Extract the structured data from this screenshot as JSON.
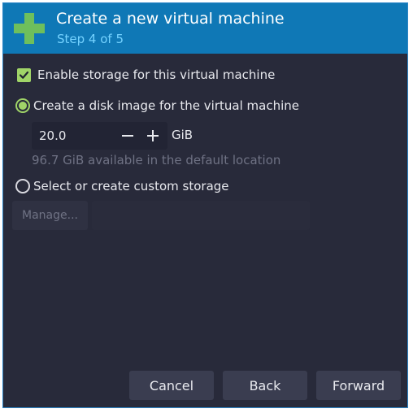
{
  "header": {
    "title": "Create a new virtual machine",
    "subtitle": "Step 4 of 5",
    "logo_icon": "plus-icon",
    "logo_color": "#6ebf5c",
    "background_color": "#0f78b6",
    "subtitle_color": "#74d2ff"
  },
  "storage": {
    "enable_label": "Enable storage for this virtual machine",
    "enable_checked": true,
    "accent_color": "#a0d468",
    "options": [
      {
        "label": "Create a disk image for the virtual machine",
        "selected": true
      },
      {
        "label": "Select or create custom storage",
        "selected": false
      }
    ],
    "disk_size": "20.0",
    "disk_unit": "GiB",
    "available_hint": "96.7 GiB available in the default location",
    "manage_label": "Manage...",
    "custom_path_value": ""
  },
  "footer": {
    "cancel_label": "Cancel",
    "back_label": "Back",
    "forward_label": "Forward"
  }
}
